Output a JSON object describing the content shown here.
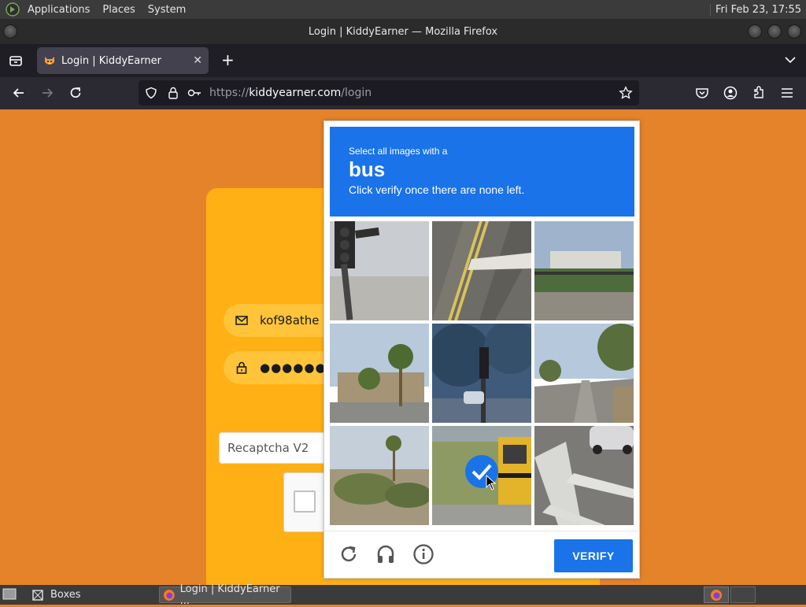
{
  "panel": {
    "menu": [
      "Applications",
      "Places",
      "System"
    ],
    "clock": "Fri Feb 23, 17:55"
  },
  "window": {
    "title": "Login | KiddyEarner — Mozilla Firefox"
  },
  "browser": {
    "tab_title": "Login | KiddyEarner",
    "url_scheme": "https://",
    "url_host": "kiddyearner.com",
    "url_path": "/login"
  },
  "page": {
    "email_value": "kof98athe",
    "password_value": "●●●●●●●●",
    "captcha_type": "Recaptcha V2"
  },
  "challenge": {
    "instruction_pre": "Select all images with a",
    "target": "bus",
    "instruction_post": "Click verify once there are none left.",
    "verify_label": "VERIFY",
    "tiles": [
      {
        "name": "traffic-light-pole",
        "selected": false
      },
      {
        "name": "road-lane-lines",
        "selected": false
      },
      {
        "name": "building-fence",
        "selected": false
      },
      {
        "name": "palm-trees-building",
        "selected": false
      },
      {
        "name": "traffic-light-street",
        "selected": false
      },
      {
        "name": "street-trees",
        "selected": false
      },
      {
        "name": "palm-bushes",
        "selected": false
      },
      {
        "name": "school-bus",
        "selected": true
      },
      {
        "name": "crosswalk-car",
        "selected": false
      }
    ]
  },
  "taskbar": {
    "items": [
      "Boxes",
      "Login | KiddyEarner ..."
    ]
  }
}
